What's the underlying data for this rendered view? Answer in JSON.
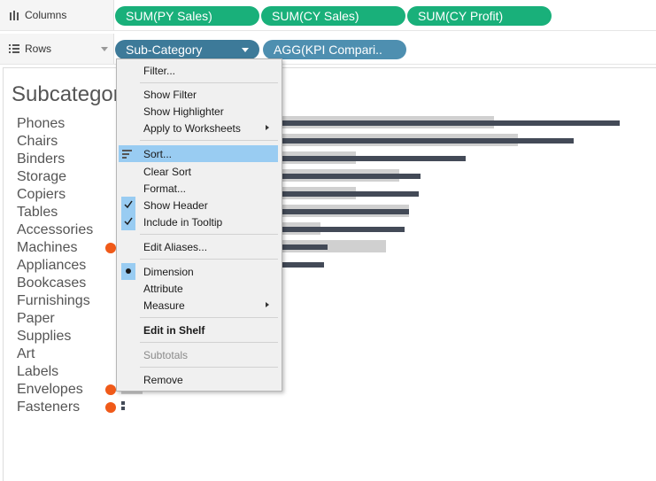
{
  "shelves": {
    "columns": {
      "label": "Columns",
      "pills": [
        "SUM(PY Sales)",
        "SUM(CY Sales)",
        "SUM(CY Profit)"
      ]
    },
    "rows": {
      "label": "Rows",
      "pills": [
        "Sub-Category",
        "AGG(KPI Compari.."
      ]
    }
  },
  "view": {
    "title": "Subcategory Comparison",
    "categories": [
      "Phones",
      "Chairs",
      "Binders",
      "Storage",
      "Copiers",
      "Tables",
      "Accessories",
      "Machines",
      "Appliances",
      "Bookcases",
      "Furnishings",
      "Paper",
      "Supplies",
      "Art",
      "Labels",
      "Envelopes",
      "Fasteners"
    ],
    "flagged": [
      "Machines",
      "Envelopes",
      "Fasteners"
    ],
    "flag_color": "#f05a19",
    "py_color": "#d0d0d0",
    "cy_color": "#434a57"
  },
  "context_menu": {
    "items": [
      "Filter...",
      "Show Filter",
      "Show Highlighter",
      "Apply to Worksheets",
      "Sort...",
      "Clear Sort",
      "Format...",
      "Show Header",
      "Include in Tooltip",
      "Edit Aliases...",
      "Dimension",
      "Attribute",
      "Measure",
      "Edit in Shelf",
      "Subtotals",
      "Remove"
    ]
  },
  "colors": {
    "green_pill": "#19b07a",
    "blue_pill": "#4e8fb0",
    "highlight": "#99ccf2"
  }
}
